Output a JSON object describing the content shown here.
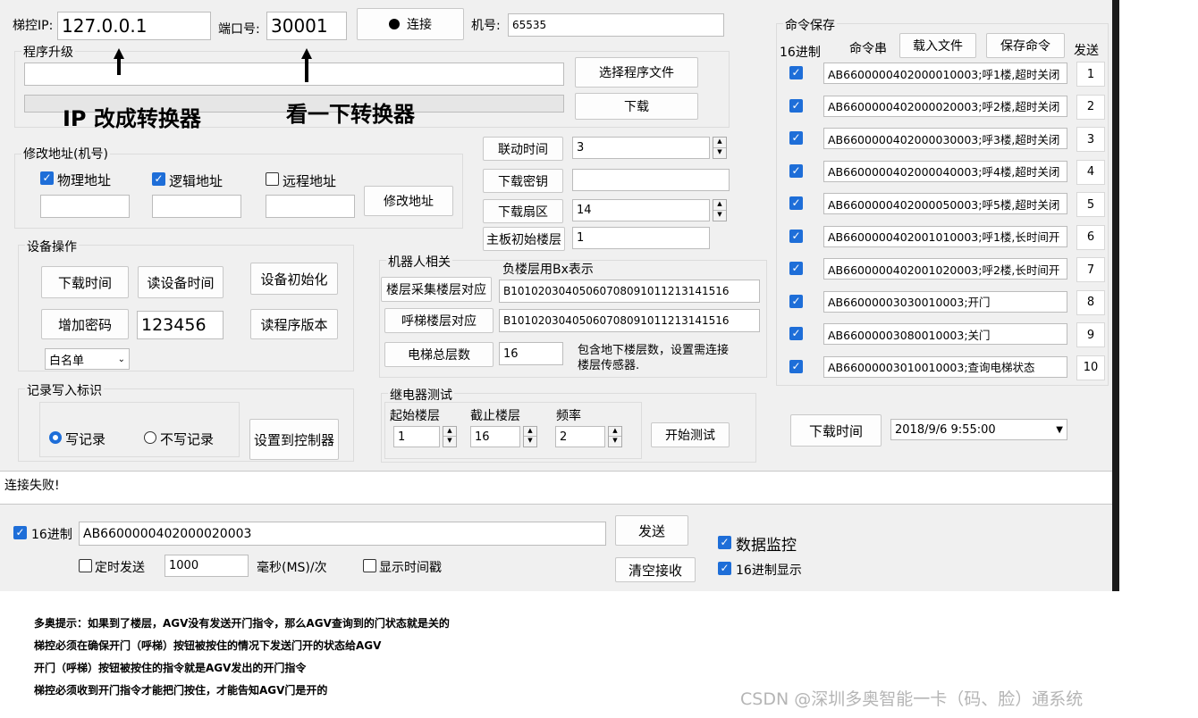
{
  "header": {
    "ip_label": "梯控IP:",
    "ip_value": "127.0.0.1",
    "port_label": "端口号:",
    "port_value": "30001",
    "connect_label": "连接",
    "machine_label": "机号:",
    "machine_value": "65535"
  },
  "upgrade": {
    "title": "程序升级",
    "select_file": "选择程序文件",
    "download": "下载",
    "annotation_ip": "IP 改成转换器",
    "annotation_port": "看一下转换器"
  },
  "address": {
    "title": "修改地址(机号)",
    "physical": "物理地址",
    "logical": "逻辑地址",
    "remote": "远程地址",
    "modify": "修改地址"
  },
  "params": [
    {
      "button": "联动时间",
      "value": "3"
    },
    {
      "button": "下载密钥",
      "value": ""
    },
    {
      "button": "下载扇区",
      "value": "14"
    },
    {
      "button": "主板初始楼层",
      "value": "1"
    }
  ],
  "device": {
    "title": "设备操作",
    "download_time": "下载时间",
    "read_time": "读设备时间",
    "init": "设备初始化",
    "add_password": "增加密码",
    "password_value": "123456",
    "read_version": "读程序版本",
    "list_select": "白名单"
  },
  "robot": {
    "title": "机器人相关",
    "note": "负楼层用Bx表示",
    "floor_map": "楼层采集楼层对应",
    "floor_map_value": "B10102030405060708091011213141516",
    "call_map": "呼梯楼层对应",
    "call_map_value": "B10102030405060708091011213141516",
    "total_floors": "电梯总层数",
    "total_value": "16",
    "total_hint_1": "包含地下楼层数，设置需连接",
    "total_hint_2": "楼层传感器."
  },
  "record": {
    "title": "记录写入标识",
    "write": "写记录",
    "nowrite": "不写记录",
    "apply": "设置到控制器"
  },
  "relay": {
    "title": "继电器测试",
    "start_label": "起始楼层",
    "end_label": "截止楼层",
    "freq_label": "频率",
    "start_value": "1",
    "end_value": "16",
    "freq_value": "2",
    "start_test": "开始测试"
  },
  "commands": {
    "title": "命令保存",
    "hex_label": "16进制",
    "str_label": "命令串",
    "load_file": "载入文件",
    "save_cmd": "保存命令",
    "send_label": "发送",
    "items": [
      {
        "text": "AB6600000402000010003;呼1楼,超时关闭",
        "n": "1"
      },
      {
        "text": "AB6600000402000020003;呼2楼,超时关闭",
        "n": "2"
      },
      {
        "text": "AB6600000402000030003;呼3楼,超时关闭",
        "n": "3"
      },
      {
        "text": "AB6600000402000040003;呼4楼,超时关闭",
        "n": "4"
      },
      {
        "text": "AB6600000402000050003;呼5楼,超时关闭",
        "n": "5"
      },
      {
        "text": "AB6600000402001010003;呼1楼,长时间开",
        "n": "6"
      },
      {
        "text": "AB6600000402001020003;呼2楼,长时间开",
        "n": "7"
      },
      {
        "text": "AB66000003030010003;开门",
        "n": "8"
      },
      {
        "text": "AB66000003080010003;关门",
        "n": "9"
      },
      {
        "text": "AB66000003010010003;查询电梯状态",
        "n": "10"
      }
    ],
    "download_time": "下载时间",
    "datetime": "2018/9/6 9:55:00"
  },
  "status": {
    "message": "连接失败!"
  },
  "sendbar": {
    "hex_label": "16进制",
    "command": "AB6600000402000020003",
    "send": "发送",
    "timer_label": "定时发送",
    "timer_value": "1000",
    "ms_label": "毫秒(MS)/次",
    "show_time": "显示时间戳",
    "clear": "清空接收",
    "monitor": "数据监控",
    "hex_display": "16进制显示"
  },
  "notes": [
    "多奥提示：如果到了楼层，AGV没有发送开门指令，那么AGV查询到的门状态就是关的",
    "梯控必须在确保开门（呼梯）按钮被按住的情况下发送门开的状态给AGV",
    "开门（呼梯）按钮被按住的指令就是AGV发出的开门指令",
    "梯控必须收到开门指令才能把门按住，才能告知AGV门是开的"
  ],
  "watermark": "CSDN @深圳多奥智能一卡（码、脸）通系统"
}
